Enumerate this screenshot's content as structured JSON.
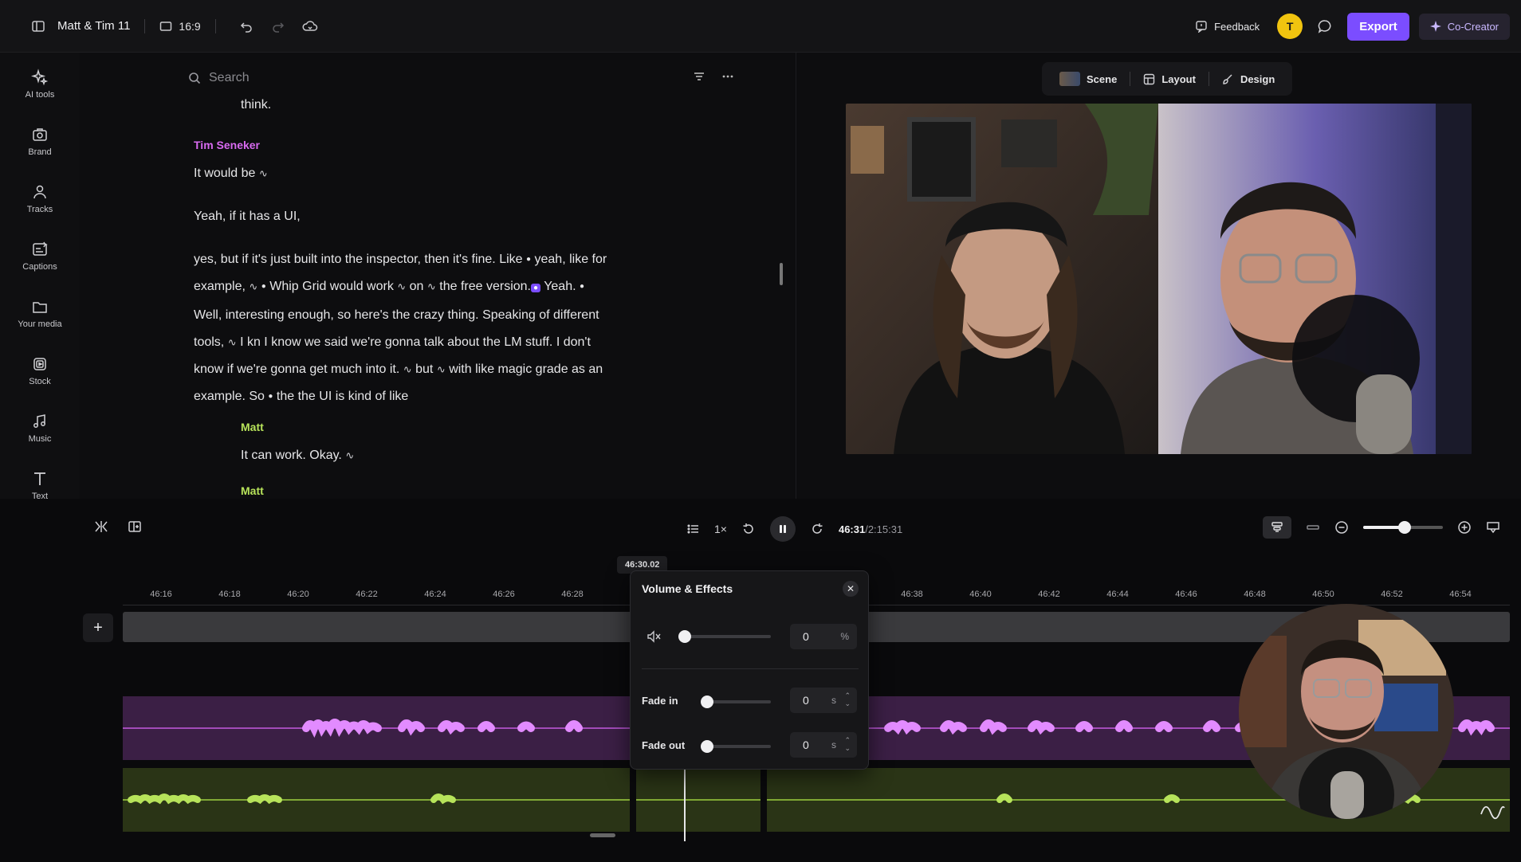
{
  "topbar": {
    "project_title": "Matt & Tim 11",
    "aspect_ratio": "16:9",
    "feedback_label": "Feedback",
    "avatar_initial": "T",
    "export_label": "Export",
    "cocreator_label": "Co-Creator"
  },
  "sidebar": {
    "items": [
      {
        "label": "AI tools",
        "icon": "sparkle-icon"
      },
      {
        "label": "Brand",
        "icon": "brand-icon"
      },
      {
        "label": "Tracks",
        "icon": "people-icon"
      },
      {
        "label": "Captions",
        "icon": "captions-icon"
      },
      {
        "label": "Your media",
        "icon": "folder-icon"
      },
      {
        "label": "Stock",
        "icon": "stock-icon"
      },
      {
        "label": "Music",
        "icon": "music-icon"
      },
      {
        "label": "Text",
        "icon": "text-icon"
      }
    ]
  },
  "transcript": {
    "search_placeholder": "Search",
    "line_think": "think.",
    "speaker_tim": "Tim Seneker",
    "line_would_be": "It would be",
    "line_yeah_ui": "Yeah, if it has a UI,",
    "para_1": "yes, but if it's just built into the inspector, then it's fine. Like",
    "para_1b": "yeah, like for",
    "para_2a": "example,",
    "para_2b": "Whip Grid would work",
    "para_2c": "on",
    "para_2d": "the free version.",
    "para_2e": "Yeah.",
    "para_3": "Well, interesting enough, so here's the crazy thing. Speaking of different",
    "para_4a": "tools,",
    "para_4b": "I kn I know we said we're gonna talk about the LM stuff. I don't",
    "para_5a": "know if we're gonna get much into it.",
    "para_5b": "but",
    "para_5c": "with like magic grade as an",
    "para_6a": "example. So",
    "para_6b": "the the UI is kind of like",
    "speaker_matt": "Matt",
    "line_can_work": "It can work. Okay.",
    "speaker_matt_2": "Matt"
  },
  "preview": {
    "tabs": [
      "Scene",
      "Layout",
      "Design"
    ]
  },
  "transport": {
    "speed": "1×",
    "current_time": "46:31",
    "total_time": "/2:15:31",
    "zoom_level": 0.52
  },
  "timeline": {
    "playhead_time": "46:30.02",
    "ruler_ticks": [
      "46:16",
      "46:18",
      "46:20",
      "46:22",
      "46:24",
      "46:26",
      "46:28",
      "46:38",
      "46:40",
      "46:42",
      "46:44",
      "46:46",
      "46:48",
      "46:50",
      "46:52",
      "46:54"
    ]
  },
  "volume_popover": {
    "title": "Volume & Effects",
    "volume_value": "0",
    "volume_unit": "%",
    "fade_in_label": "Fade in",
    "fade_in_value": "0",
    "fade_out_label": "Fade out",
    "fade_out_value": "0",
    "seconds_unit": "s"
  },
  "colors": {
    "accent": "#7b4dff",
    "tim_speaker": "#d86af0",
    "matt_speaker": "#b7e35a",
    "track_purple": "#3b1f45",
    "track_green": "#2a3416"
  }
}
